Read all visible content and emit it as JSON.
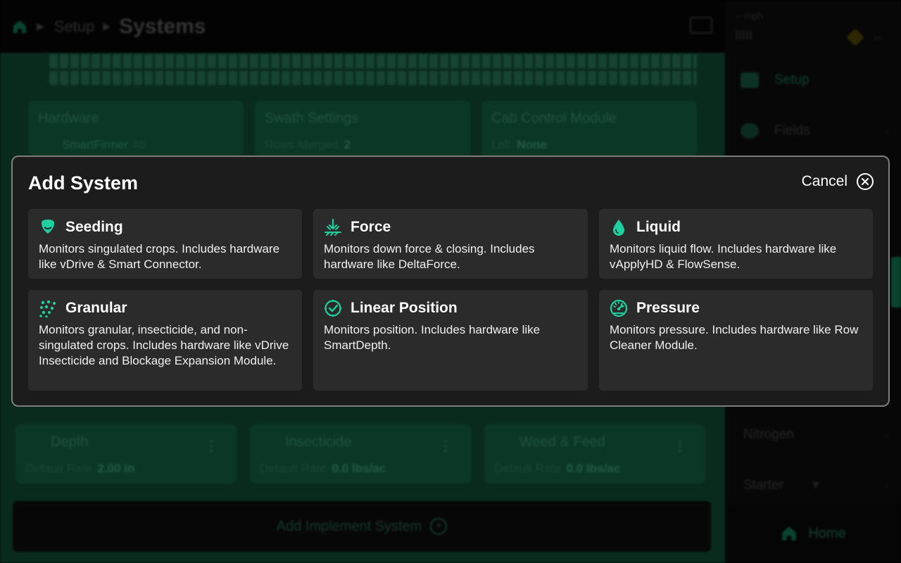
{
  "colors": {
    "accent": "#1fd0a0",
    "modal_bg": "#1c1c1c",
    "tile_bg": "#2b2b2b",
    "background_green": "#0b3a29"
  },
  "header": {
    "home_icon": "home-icon",
    "crumb": "Setup",
    "title": "Systems"
  },
  "sidebar": {
    "speed_unit": "-- mph",
    "signal": "IIIII",
    "items": [
      {
        "label": "Setup",
        "icon": "setup-icon"
      },
      {
        "label": "Fields",
        "icon": "fields-icon"
      },
      {
        "label": "Nitrogen"
      },
      {
        "label": "Starter"
      }
    ],
    "home_label": "Home"
  },
  "background_cards": {
    "hardware": {
      "title": "Hardware",
      "item": "SmartFirmer",
      "count": "48"
    },
    "swath": {
      "title": "Swath Settings",
      "key": "Rows Merged",
      "value": "2"
    },
    "cab": {
      "title": "Cab Control Module",
      "key": "Left",
      "value": "None"
    },
    "depth": {
      "title": "Depth",
      "key": "Default Rate",
      "value": "2.00 in"
    },
    "insecticide": {
      "title": "Insecticide",
      "key": "Default Rate",
      "value": "0.0 lbs/ac"
    },
    "weed_feed": {
      "title": "Weed & Feed",
      "key": "Default Rate",
      "value": "0.0 lbs/ac"
    },
    "add_implement": "Add Implement System"
  },
  "modal": {
    "title": "Add System",
    "cancel_label": "Cancel",
    "systems": [
      {
        "name": "Seeding",
        "icon": "seed-icon",
        "description": "Monitors singulated crops. Includes hardware like vDrive & Smart Connector."
      },
      {
        "name": "Force",
        "icon": "force-icon",
        "description": "Monitors down force & closing. Includes hardware like DeltaForce."
      },
      {
        "name": "Liquid",
        "icon": "droplet-icon",
        "description": "Monitors liquid flow. Includes hardware like vApplyHD & FlowSense."
      },
      {
        "name": "Granular",
        "icon": "granules-icon",
        "description": "Monitors granular, insecticide, and non-singulated crops. Includes hardware like vDrive Insecticide and Blockage Expansion Module."
      },
      {
        "name": "Linear Position",
        "icon": "linear-position-icon",
        "description": "Monitors position. Includes hardware like SmartDepth."
      },
      {
        "name": "Pressure",
        "icon": "gauge-icon",
        "description": "Monitors pressure. Includes hardware like Row Cleaner Module."
      }
    ]
  }
}
